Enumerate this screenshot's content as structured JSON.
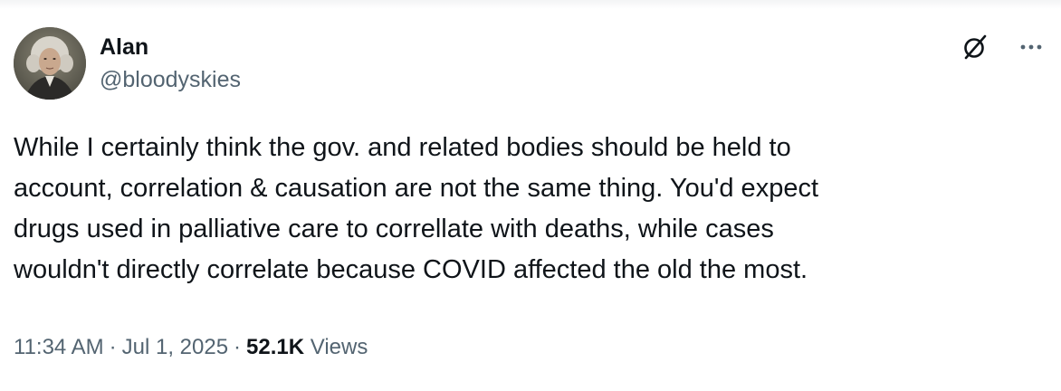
{
  "author": {
    "display_name": "Alan",
    "handle": "@bloodyskies",
    "avatar_icon": "portrait-avatar"
  },
  "icons": {
    "grok": "grok-icon",
    "more": "more-icon"
  },
  "tweet": {
    "text": "While I certainly think the gov. and related bodies should be held to\naccount, correlation & causation are not the same thing. You'd expect\ndrugs used  in palliative care to correllate with deaths, while cases\nwouldn't directly correlate because COVID affected the old the most."
  },
  "meta": {
    "time": "11:34 AM",
    "separator": "·",
    "date": "Jul 1, 2025",
    "views_count": "52.1K",
    "views_label": "Views"
  },
  "colors": {
    "text_primary": "#0f1419",
    "text_secondary": "#536471",
    "background": "#ffffff"
  }
}
